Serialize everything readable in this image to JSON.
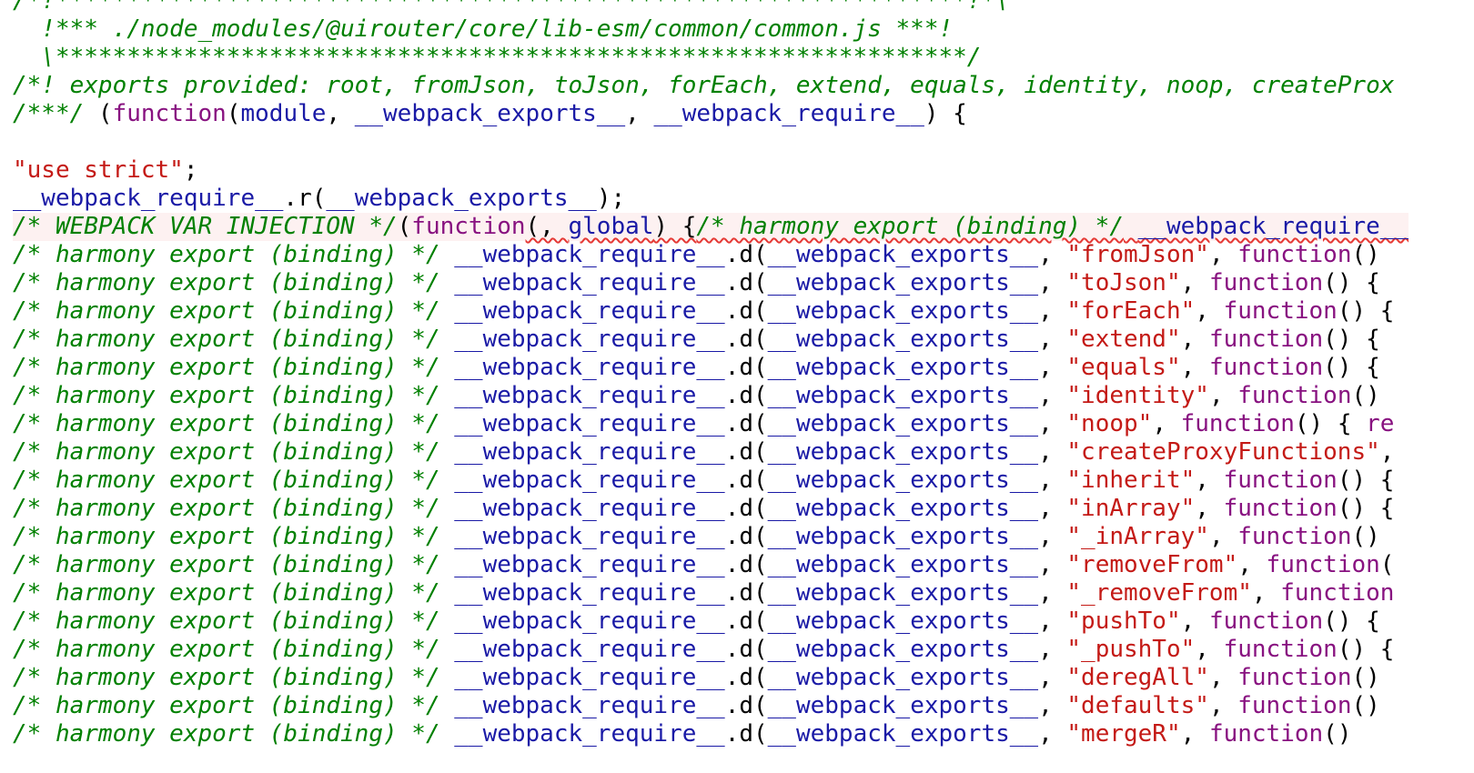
{
  "editor": {
    "colors": {
      "comment": "#008000",
      "identifier": "#1a1aa6",
      "keyword": "#881280",
      "string": "#c41a16",
      "punctuation": "#000000",
      "error_underline": "#e53935"
    },
    "lines": [
      {
        "tokens": [
          {
            "c": "/*!****************************************************************!*\\",
            "t": "c"
          }
        ]
      },
      {
        "tokens": [
          {
            "c": "  !*** ./node_modules/@uirouter/core/lib-esm/common/common.js ***!",
            "t": "c"
          }
        ]
      },
      {
        "tokens": [
          {
            "c": "  \\****************************************************************/",
            "t": "c"
          }
        ]
      },
      {
        "tokens": [
          {
            "c": "/*! exports provided: root, fromJson, toJson, forEach, extend, equals, identity, noop, createProx",
            "t": "c"
          }
        ]
      },
      {
        "tokens": [
          {
            "c": "/***/",
            "t": "c"
          },
          {
            "c": " (",
            "t": "p"
          },
          {
            "c": "function",
            "t": "k"
          },
          {
            "c": "(",
            "t": "p"
          },
          {
            "c": "module",
            "t": "i"
          },
          {
            "c": ", ",
            "t": "p"
          },
          {
            "c": "__webpack_exports__",
            "t": "i"
          },
          {
            "c": ", ",
            "t": "p"
          },
          {
            "c": "__webpack_require__",
            "t": "i"
          },
          {
            "c": ") {",
            "t": "p"
          }
        ]
      },
      {
        "tokens": [
          {
            "c": " ",
            "t": "p"
          }
        ]
      },
      {
        "tokens": [
          {
            "c": "\"use strict\"",
            "t": "s"
          },
          {
            "c": ";",
            "t": "p"
          }
        ]
      },
      {
        "tokens": [
          {
            "c": "__webpack_require__",
            "t": "i"
          },
          {
            "c": ".r(",
            "t": "p"
          },
          {
            "c": "__webpack_exports__",
            "t": "i"
          },
          {
            "c": ");",
            "t": "p"
          }
        ]
      },
      {
        "error": true,
        "tokens": [
          {
            "c": "/* WEBPACK VAR INJECTION */",
            "t": "c"
          },
          {
            "c": "(",
            "t": "p"
          },
          {
            "c": "function",
            "t": "k"
          },
          {
            "c": "(, ",
            "t": "p",
            "sq": true
          },
          {
            "c": "global",
            "t": "i",
            "sq": true
          },
          {
            "c": ") {",
            "t": "p",
            "sq": true
          },
          {
            "c": "/* harmony export (binding) */",
            "t": "c",
            "sq": true
          },
          {
            "c": " ",
            "t": "p",
            "sq": true
          },
          {
            "c": "__webpack_require__",
            "t": "i",
            "sq": true
          }
        ]
      },
      {
        "tokens": [
          {
            "c": "/* harmony export (binding) */",
            "t": "c"
          },
          {
            "c": " ",
            "t": "p"
          },
          {
            "c": "__webpack_require__",
            "t": "i"
          },
          {
            "c": ".d(",
            "t": "p"
          },
          {
            "c": "__webpack_exports__",
            "t": "i"
          },
          {
            "c": ", ",
            "t": "p"
          },
          {
            "c": "\"fromJson\"",
            "t": "s"
          },
          {
            "c": ", ",
            "t": "p"
          },
          {
            "c": "function",
            "t": "k"
          },
          {
            "c": "()",
            "t": "p"
          }
        ]
      },
      {
        "tokens": [
          {
            "c": "/* harmony export (binding) */",
            "t": "c"
          },
          {
            "c": " ",
            "t": "p"
          },
          {
            "c": "__webpack_require__",
            "t": "i"
          },
          {
            "c": ".d(",
            "t": "p"
          },
          {
            "c": "__webpack_exports__",
            "t": "i"
          },
          {
            "c": ", ",
            "t": "p"
          },
          {
            "c": "\"toJson\"",
            "t": "s"
          },
          {
            "c": ", ",
            "t": "p"
          },
          {
            "c": "function",
            "t": "k"
          },
          {
            "c": "() {",
            "t": "p"
          }
        ]
      },
      {
        "tokens": [
          {
            "c": "/* harmony export (binding) */",
            "t": "c"
          },
          {
            "c": " ",
            "t": "p"
          },
          {
            "c": "__webpack_require__",
            "t": "i"
          },
          {
            "c": ".d(",
            "t": "p"
          },
          {
            "c": "__webpack_exports__",
            "t": "i"
          },
          {
            "c": ", ",
            "t": "p"
          },
          {
            "c": "\"forEach\"",
            "t": "s"
          },
          {
            "c": ", ",
            "t": "p"
          },
          {
            "c": "function",
            "t": "k"
          },
          {
            "c": "() {",
            "t": "p"
          }
        ]
      },
      {
        "tokens": [
          {
            "c": "/* harmony export (binding) */",
            "t": "c"
          },
          {
            "c": " ",
            "t": "p"
          },
          {
            "c": "__webpack_require__",
            "t": "i"
          },
          {
            "c": ".d(",
            "t": "p"
          },
          {
            "c": "__webpack_exports__",
            "t": "i"
          },
          {
            "c": ", ",
            "t": "p"
          },
          {
            "c": "\"extend\"",
            "t": "s"
          },
          {
            "c": ", ",
            "t": "p"
          },
          {
            "c": "function",
            "t": "k"
          },
          {
            "c": "() {",
            "t": "p"
          }
        ]
      },
      {
        "tokens": [
          {
            "c": "/* harmony export (binding) */",
            "t": "c"
          },
          {
            "c": " ",
            "t": "p"
          },
          {
            "c": "__webpack_require__",
            "t": "i"
          },
          {
            "c": ".d(",
            "t": "p"
          },
          {
            "c": "__webpack_exports__",
            "t": "i"
          },
          {
            "c": ", ",
            "t": "p"
          },
          {
            "c": "\"equals\"",
            "t": "s"
          },
          {
            "c": ", ",
            "t": "p"
          },
          {
            "c": "function",
            "t": "k"
          },
          {
            "c": "() {",
            "t": "p"
          }
        ]
      },
      {
        "tokens": [
          {
            "c": "/* harmony export (binding) */",
            "t": "c"
          },
          {
            "c": " ",
            "t": "p"
          },
          {
            "c": "__webpack_require__",
            "t": "i"
          },
          {
            "c": ".d(",
            "t": "p"
          },
          {
            "c": "__webpack_exports__",
            "t": "i"
          },
          {
            "c": ", ",
            "t": "p"
          },
          {
            "c": "\"identity\"",
            "t": "s"
          },
          {
            "c": ", ",
            "t": "p"
          },
          {
            "c": "function",
            "t": "k"
          },
          {
            "c": "()",
            "t": "p"
          }
        ]
      },
      {
        "tokens": [
          {
            "c": "/* harmony export (binding) */",
            "t": "c"
          },
          {
            "c": " ",
            "t": "p"
          },
          {
            "c": "__webpack_require__",
            "t": "i"
          },
          {
            "c": ".d(",
            "t": "p"
          },
          {
            "c": "__webpack_exports__",
            "t": "i"
          },
          {
            "c": ", ",
            "t": "p"
          },
          {
            "c": "\"noop\"",
            "t": "s"
          },
          {
            "c": ", ",
            "t": "p"
          },
          {
            "c": "function",
            "t": "k"
          },
          {
            "c": "() { ",
            "t": "p"
          },
          {
            "c": "re",
            "t": "k"
          }
        ]
      },
      {
        "tokens": [
          {
            "c": "/* harmony export (binding) */",
            "t": "c"
          },
          {
            "c": " ",
            "t": "p"
          },
          {
            "c": "__webpack_require__",
            "t": "i"
          },
          {
            "c": ".d(",
            "t": "p"
          },
          {
            "c": "__webpack_exports__",
            "t": "i"
          },
          {
            "c": ", ",
            "t": "p"
          },
          {
            "c": "\"createProxyFunctions\"",
            "t": "s"
          },
          {
            "c": ",",
            "t": "p"
          }
        ]
      },
      {
        "tokens": [
          {
            "c": "/* harmony export (binding) */",
            "t": "c"
          },
          {
            "c": " ",
            "t": "p"
          },
          {
            "c": "__webpack_require__",
            "t": "i"
          },
          {
            "c": ".d(",
            "t": "p"
          },
          {
            "c": "__webpack_exports__",
            "t": "i"
          },
          {
            "c": ", ",
            "t": "p"
          },
          {
            "c": "\"inherit\"",
            "t": "s"
          },
          {
            "c": ", ",
            "t": "p"
          },
          {
            "c": "function",
            "t": "k"
          },
          {
            "c": "() {",
            "t": "p"
          }
        ]
      },
      {
        "tokens": [
          {
            "c": "/* harmony export (binding) */",
            "t": "c"
          },
          {
            "c": " ",
            "t": "p"
          },
          {
            "c": "__webpack_require__",
            "t": "i"
          },
          {
            "c": ".d(",
            "t": "p"
          },
          {
            "c": "__webpack_exports__",
            "t": "i"
          },
          {
            "c": ", ",
            "t": "p"
          },
          {
            "c": "\"inArray\"",
            "t": "s"
          },
          {
            "c": ", ",
            "t": "p"
          },
          {
            "c": "function",
            "t": "k"
          },
          {
            "c": "() {",
            "t": "p"
          }
        ]
      },
      {
        "tokens": [
          {
            "c": "/* harmony export (binding) */",
            "t": "c"
          },
          {
            "c": " ",
            "t": "p"
          },
          {
            "c": "__webpack_require__",
            "t": "i"
          },
          {
            "c": ".d(",
            "t": "p"
          },
          {
            "c": "__webpack_exports__",
            "t": "i"
          },
          {
            "c": ", ",
            "t": "p"
          },
          {
            "c": "\"_inArray\"",
            "t": "s"
          },
          {
            "c": ", ",
            "t": "p"
          },
          {
            "c": "function",
            "t": "k"
          },
          {
            "c": "()",
            "t": "p"
          }
        ]
      },
      {
        "tokens": [
          {
            "c": "/* harmony export (binding) */",
            "t": "c"
          },
          {
            "c": " ",
            "t": "p"
          },
          {
            "c": "__webpack_require__",
            "t": "i"
          },
          {
            "c": ".d(",
            "t": "p"
          },
          {
            "c": "__webpack_exports__",
            "t": "i"
          },
          {
            "c": ", ",
            "t": "p"
          },
          {
            "c": "\"removeFrom\"",
            "t": "s"
          },
          {
            "c": ", ",
            "t": "p"
          },
          {
            "c": "function",
            "t": "k"
          },
          {
            "c": "(",
            "t": "p"
          }
        ]
      },
      {
        "tokens": [
          {
            "c": "/* harmony export (binding) */",
            "t": "c"
          },
          {
            "c": " ",
            "t": "p"
          },
          {
            "c": "__webpack_require__",
            "t": "i"
          },
          {
            "c": ".d(",
            "t": "p"
          },
          {
            "c": "__webpack_exports__",
            "t": "i"
          },
          {
            "c": ", ",
            "t": "p"
          },
          {
            "c": "\"_removeFrom\"",
            "t": "s"
          },
          {
            "c": ", ",
            "t": "p"
          },
          {
            "c": "function",
            "t": "k"
          }
        ]
      },
      {
        "tokens": [
          {
            "c": "/* harmony export (binding) */",
            "t": "c"
          },
          {
            "c": " ",
            "t": "p"
          },
          {
            "c": "__webpack_require__",
            "t": "i"
          },
          {
            "c": ".d(",
            "t": "p"
          },
          {
            "c": "__webpack_exports__",
            "t": "i"
          },
          {
            "c": ", ",
            "t": "p"
          },
          {
            "c": "\"pushTo\"",
            "t": "s"
          },
          {
            "c": ", ",
            "t": "p"
          },
          {
            "c": "function",
            "t": "k"
          },
          {
            "c": "() {",
            "t": "p"
          }
        ]
      },
      {
        "tokens": [
          {
            "c": "/* harmony export (binding) */",
            "t": "c"
          },
          {
            "c": " ",
            "t": "p"
          },
          {
            "c": "__webpack_require__",
            "t": "i"
          },
          {
            "c": ".d(",
            "t": "p"
          },
          {
            "c": "__webpack_exports__",
            "t": "i"
          },
          {
            "c": ", ",
            "t": "p"
          },
          {
            "c": "\"_pushTo\"",
            "t": "s"
          },
          {
            "c": ", ",
            "t": "p"
          },
          {
            "c": "function",
            "t": "k"
          },
          {
            "c": "() {",
            "t": "p"
          }
        ]
      },
      {
        "tokens": [
          {
            "c": "/* harmony export (binding) */",
            "t": "c"
          },
          {
            "c": " ",
            "t": "p"
          },
          {
            "c": "__webpack_require__",
            "t": "i"
          },
          {
            "c": ".d(",
            "t": "p"
          },
          {
            "c": "__webpack_exports__",
            "t": "i"
          },
          {
            "c": ", ",
            "t": "p"
          },
          {
            "c": "\"deregAll\"",
            "t": "s"
          },
          {
            "c": ", ",
            "t": "p"
          },
          {
            "c": "function",
            "t": "k"
          },
          {
            "c": "()",
            "t": "p"
          }
        ]
      },
      {
        "tokens": [
          {
            "c": "/* harmony export (binding) */",
            "t": "c"
          },
          {
            "c": " ",
            "t": "p"
          },
          {
            "c": "__webpack_require__",
            "t": "i"
          },
          {
            "c": ".d(",
            "t": "p"
          },
          {
            "c": "__webpack_exports__",
            "t": "i"
          },
          {
            "c": ", ",
            "t": "p"
          },
          {
            "c": "\"defaults\"",
            "t": "s"
          },
          {
            "c": ", ",
            "t": "p"
          },
          {
            "c": "function",
            "t": "k"
          },
          {
            "c": "()",
            "t": "p"
          }
        ]
      },
      {
        "tokens": [
          {
            "c": "/* harmony export (binding) */",
            "t": "c"
          },
          {
            "c": " ",
            "t": "p"
          },
          {
            "c": "__webpack_require__",
            "t": "i"
          },
          {
            "c": ".d(",
            "t": "p"
          },
          {
            "c": "__webpack_exports__",
            "t": "i"
          },
          {
            "c": ", ",
            "t": "p"
          },
          {
            "c": "\"mergeR\"",
            "t": "s"
          },
          {
            "c": ", ",
            "t": "p"
          },
          {
            "c": "function",
            "t": "k"
          },
          {
            "c": "()",
            "t": "p"
          }
        ]
      }
    ]
  }
}
